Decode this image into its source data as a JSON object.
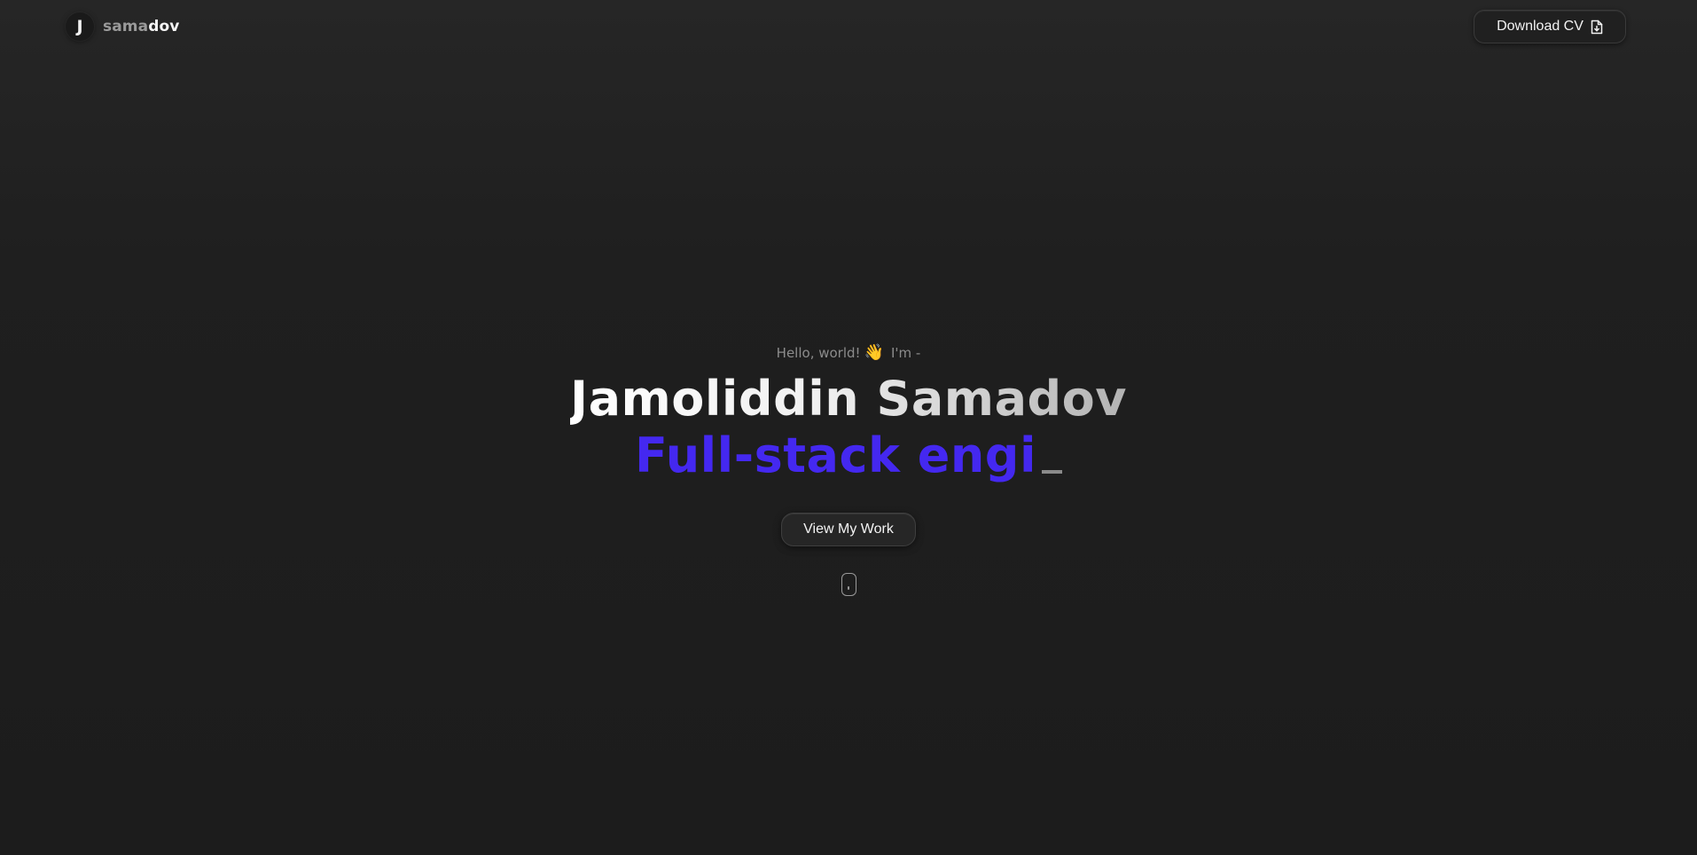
{
  "header": {
    "logo_letter": "J",
    "brand_part1": "sama",
    "brand_part2": "dov",
    "download_cv_label": "Download CV",
    "download_cv_icon": "file-download-icon"
  },
  "hero": {
    "greeting_before": "Hello, world!",
    "greeting_emoji": "👋",
    "greeting_after": "I'm -",
    "name": "Jamoliddin Samadov",
    "role_typed": "Full-stack engi",
    "view_work_label": "View My Work",
    "scroll_icon": "scroll-mouse-icon"
  },
  "colors": {
    "background": "#1f1f1f",
    "role_accent": "#4428f0",
    "muted_text": "#8c8c8c"
  }
}
